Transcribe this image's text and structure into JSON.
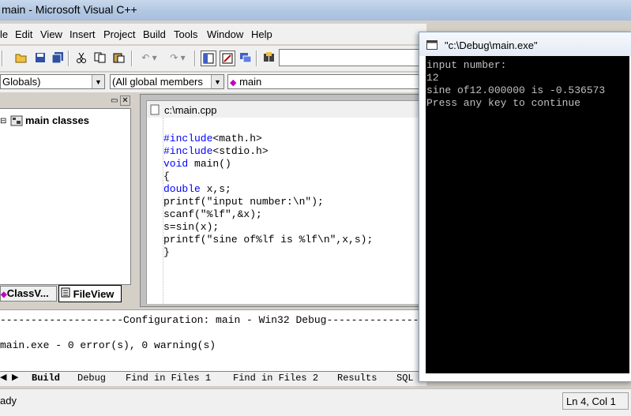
{
  "window": {
    "title": "main - Microsoft Visual C++"
  },
  "menu": [
    "le",
    "Edit",
    "View",
    "Insert",
    "Project",
    "Build",
    "Tools",
    "Window",
    "Help"
  ],
  "toolbar": {
    "icons": [
      "open-folder-icon",
      "save-icon",
      "save-all-icon",
      "cut-icon",
      "copy-icon",
      "paste-icon",
      "undo-icon",
      "redo-icon",
      "workspace-icon",
      "output-icon",
      "window-list-icon",
      "find-in-files-icon"
    ],
    "find_value": ""
  },
  "wizardbar": {
    "class_combo": "Globals)",
    "members_combo": "(All global members",
    "function_combo": "main"
  },
  "workspace": {
    "tree_root": "main classes",
    "tabs": [
      "ClassV...",
      "FileView"
    ]
  },
  "editor": {
    "tab_title": "c:\\main.cpp",
    "lines": [
      {
        "kw": "#include",
        "rest": "<math.h>"
      },
      {
        "kw": "#include",
        "rest": "<stdio.h>"
      },
      {
        "kw": "void",
        "rest": " main()"
      },
      {
        "kw": "",
        "rest": "{"
      },
      {
        "kw": "double",
        "rest": " x,s;"
      },
      {
        "kw": "",
        "rest": "printf(\"input number:\\n\");"
      },
      {
        "kw": "",
        "rest": "scanf(\"%lf\",&x);"
      },
      {
        "kw": "",
        "rest": "s=sin(x);"
      },
      {
        "kw": "",
        "rest": "printf(\"sine of%lf is %lf\\n\",x,s);"
      },
      {
        "kw": "",
        "rest": "}"
      }
    ]
  },
  "output": {
    "lines": [
      "--------------------Configuration: main - Win32 Debug--------------------",
      "main.exe - 0 error(s), 0 warning(s)"
    ],
    "tabs": [
      "Build",
      "Debug",
      "Find in Files 1",
      "Find in Files 2",
      "Results",
      "SQL"
    ]
  },
  "statusbar": {
    "left": "ady",
    "position": "Ln 4, Col 1"
  },
  "console": {
    "title": "\"c:\\Debug\\main.exe\"",
    "lines": [
      "input number:",
      "12",
      "sine of12.000000 is -0.536573",
      "Press any key to continue"
    ]
  },
  "colors": {
    "keyword": "#0000ff",
    "console_bg": "#000000",
    "console_text": "#c0c0c0"
  }
}
